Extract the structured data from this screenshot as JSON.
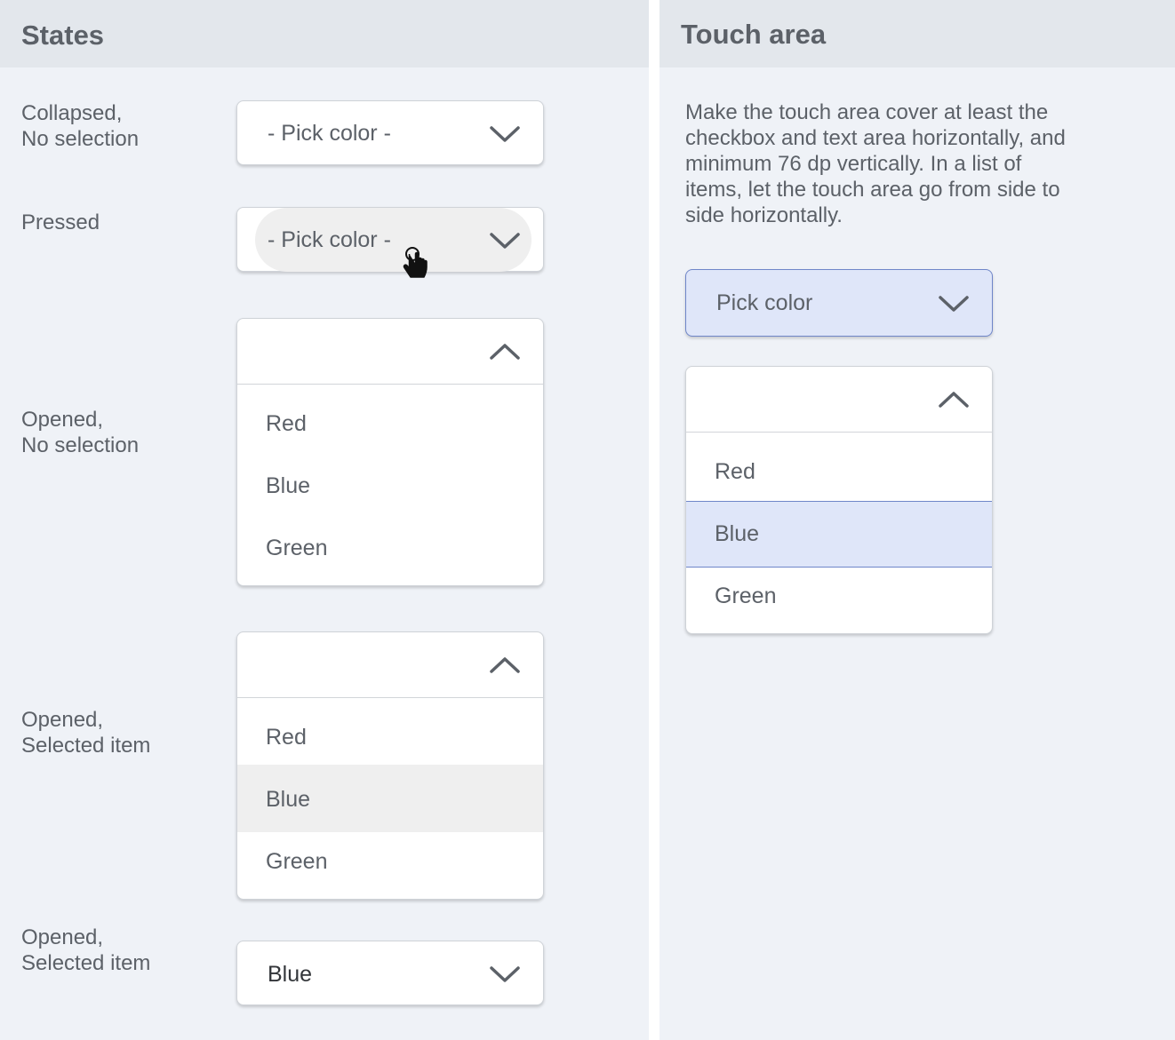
{
  "left_panel": {
    "title": "States",
    "rows": [
      {
        "label": "Collapsed,\nNo selection"
      },
      {
        "label": "Pressed"
      },
      {
        "label": "Opened,\nNo selection"
      },
      {
        "label": "Opened,\nSelected item"
      },
      {
        "label": "Opened,\nSelected item"
      }
    ],
    "collapsed_dropdown": {
      "value": "- Pick color -",
      "icon": "chevron-down-icon"
    },
    "pressed_dropdown": {
      "value": "- Pick color -",
      "icon": "chevron-down-icon",
      "cursor": "hand-pointer-icon"
    },
    "opened_dropdown": {
      "icon": "chevron-up-icon",
      "options": [
        "Red",
        "Blue",
        "Green"
      ]
    },
    "opened_selected_dropdown": {
      "icon": "chevron-up-icon",
      "options": [
        "Red",
        "Blue",
        "Green"
      ],
      "selected": "Blue"
    },
    "selected_dropdown": {
      "value": "Blue",
      "icon": "chevron-down-icon"
    }
  },
  "right_panel": {
    "title": "Touch area",
    "description": "Make the touch area cover at least the checkbox and text area horizontally, and minimum 76 dp vertically. In a list of items, let the touch area go from side to side horizontally.",
    "touch_dropdown": {
      "value": "Pick color",
      "icon": "chevron-down-icon"
    },
    "touch_menu": {
      "icon": "chevron-up-icon",
      "options": [
        "Red",
        "Blue",
        "Green"
      ],
      "selected": "Blue"
    }
  },
  "colors": {
    "panel_bg": "#eff2f7",
    "header_bg": "#e3e7ec",
    "selected_grey": "#efefef",
    "touch_highlight": "#dfe6f9",
    "touch_border": "#6f86c9"
  }
}
